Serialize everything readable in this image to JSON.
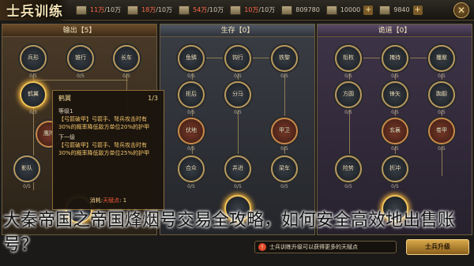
{
  "header": {
    "logo": "士兵训练",
    "resources": [
      {
        "icon": "army-icon",
        "value": "11万",
        "max": "/10万"
      },
      {
        "icon": "supply-icon",
        "value": "18万",
        "max": "/10万"
      },
      {
        "icon": "food-icon",
        "value": "54万",
        "max": "/10万"
      },
      {
        "icon": "gold-icon",
        "value": "10万",
        "max": "/10万"
      },
      {
        "icon": "silver-icon",
        "value": "809780"
      },
      {
        "icon": "coin-icon",
        "value": "10000"
      },
      {
        "icon": "jade-icon",
        "value": "9840"
      }
    ],
    "close_icon": "close-icon"
  },
  "panels": [
    {
      "title": "输出【5】",
      "nodes": [
        {
          "label": "兵形",
          "count": "0/5"
        },
        {
          "label": "锥行",
          "count": "0/5"
        },
        {
          "label": "长车",
          "count": "0/5"
        },
        {
          "label": "鹤翼",
          "count": "0/3"
        },
        {
          "label": "鹰阵",
          "count": ""
        },
        {
          "label": "断粮",
          "count": ""
        },
        {
          "label": "影队",
          "count": "0/5"
        },
        {
          "label": "",
          "count": "0/5"
        }
      ]
    },
    {
      "title": "生存【0】",
      "nodes": [
        {
          "label": "鱼鳞",
          "count": "0/5"
        },
        {
          "label": "钩行",
          "count": "0/5"
        },
        {
          "label": "铁黎",
          "count": "0/5"
        },
        {
          "label": "拒后",
          "count": "0/5"
        },
        {
          "label": "分马",
          "count": "0/5"
        },
        {
          "label": "伏地",
          "count": "0/5"
        },
        {
          "label": "甲卫",
          "count": "0/5"
        },
        {
          "label": "合众",
          "count": "0/5"
        },
        {
          "label": "井进",
          "count": "0/5"
        },
        {
          "label": "梁车",
          "count": "0/5"
        }
      ]
    },
    {
      "title": "诡道【0】",
      "nodes": [
        {
          "label": "衔枚",
          "count": "0/5"
        },
        {
          "label": "掩待",
          "count": "0/5"
        },
        {
          "label": "覆敝",
          "count": "0/5"
        },
        {
          "label": "方圆",
          "count": "0/5"
        },
        {
          "label": "锋矢",
          "count": "0/5"
        },
        {
          "label": "踟蹰",
          "count": "0/5"
        },
        {
          "label": "玄襄",
          "count": "0/5"
        },
        {
          "label": "卷甲",
          "count": "0/5"
        },
        {
          "label": "险势",
          "count": "0/5"
        },
        {
          "label": "折冲",
          "count": "0/5"
        },
        {
          "label": "",
          "count": "0/5"
        }
      ]
    }
  ],
  "tooltip": {
    "name": "鹤翼",
    "level": "1/3",
    "cur_label": "等级1",
    "cur_text": "【弓箭破甲】弓箭手、弩兵攻击时有30%的概率降低敌方单位20%的护甲",
    "next_label": "下一级",
    "next_text": "【弓箭破甲】弓箭手、弩兵攻击时有30%的概率降低敌方单位25%的护甲",
    "consume_label": "消耗:",
    "consume_res": "天赋点",
    "consume_val": ": 1"
  },
  "notice": {
    "text": "士兵训练升级可以获得更多的天赋点"
  },
  "unlock_button": "士兵升级",
  "overlay": {
    "text": "大秦帝国之帝国烽烟号交易全攻略，如何安全高效地出售账号？"
  }
}
